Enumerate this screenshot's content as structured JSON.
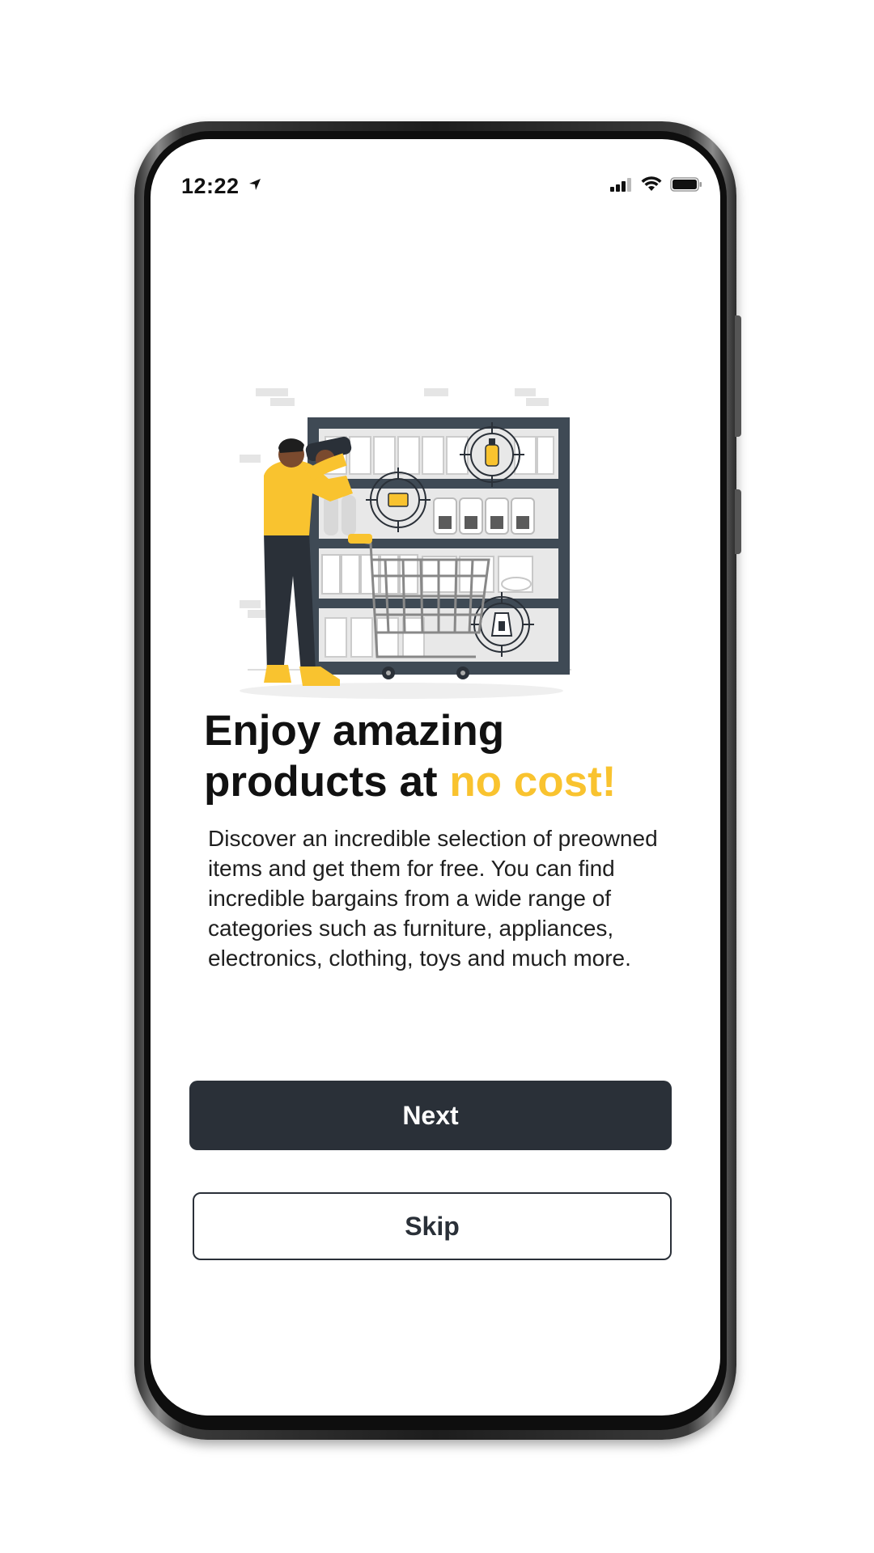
{
  "status_bar": {
    "time": "12:22",
    "location_icon": "location-arrow-icon",
    "signal_icon": "cellular-signal-icon",
    "wifi_icon": "wifi-icon",
    "battery_icon": "battery-icon"
  },
  "onboarding": {
    "illustration": "shopping-shelf-illustration",
    "headline_part1": "Enjoy amazing products at ",
    "headline_accent": "no cost!",
    "description": "Discover an incredible selection of preowned items and get them for free. You can find incredible bargains from a wide range of categories such as furniture, appliances, electronics, clothing, toys and much more."
  },
  "actions": {
    "next_label": "Next",
    "skip_label": "Skip"
  },
  "colors": {
    "accent": "#F9C32F",
    "primary": "#2A3038",
    "background": "#FFFFFF"
  }
}
